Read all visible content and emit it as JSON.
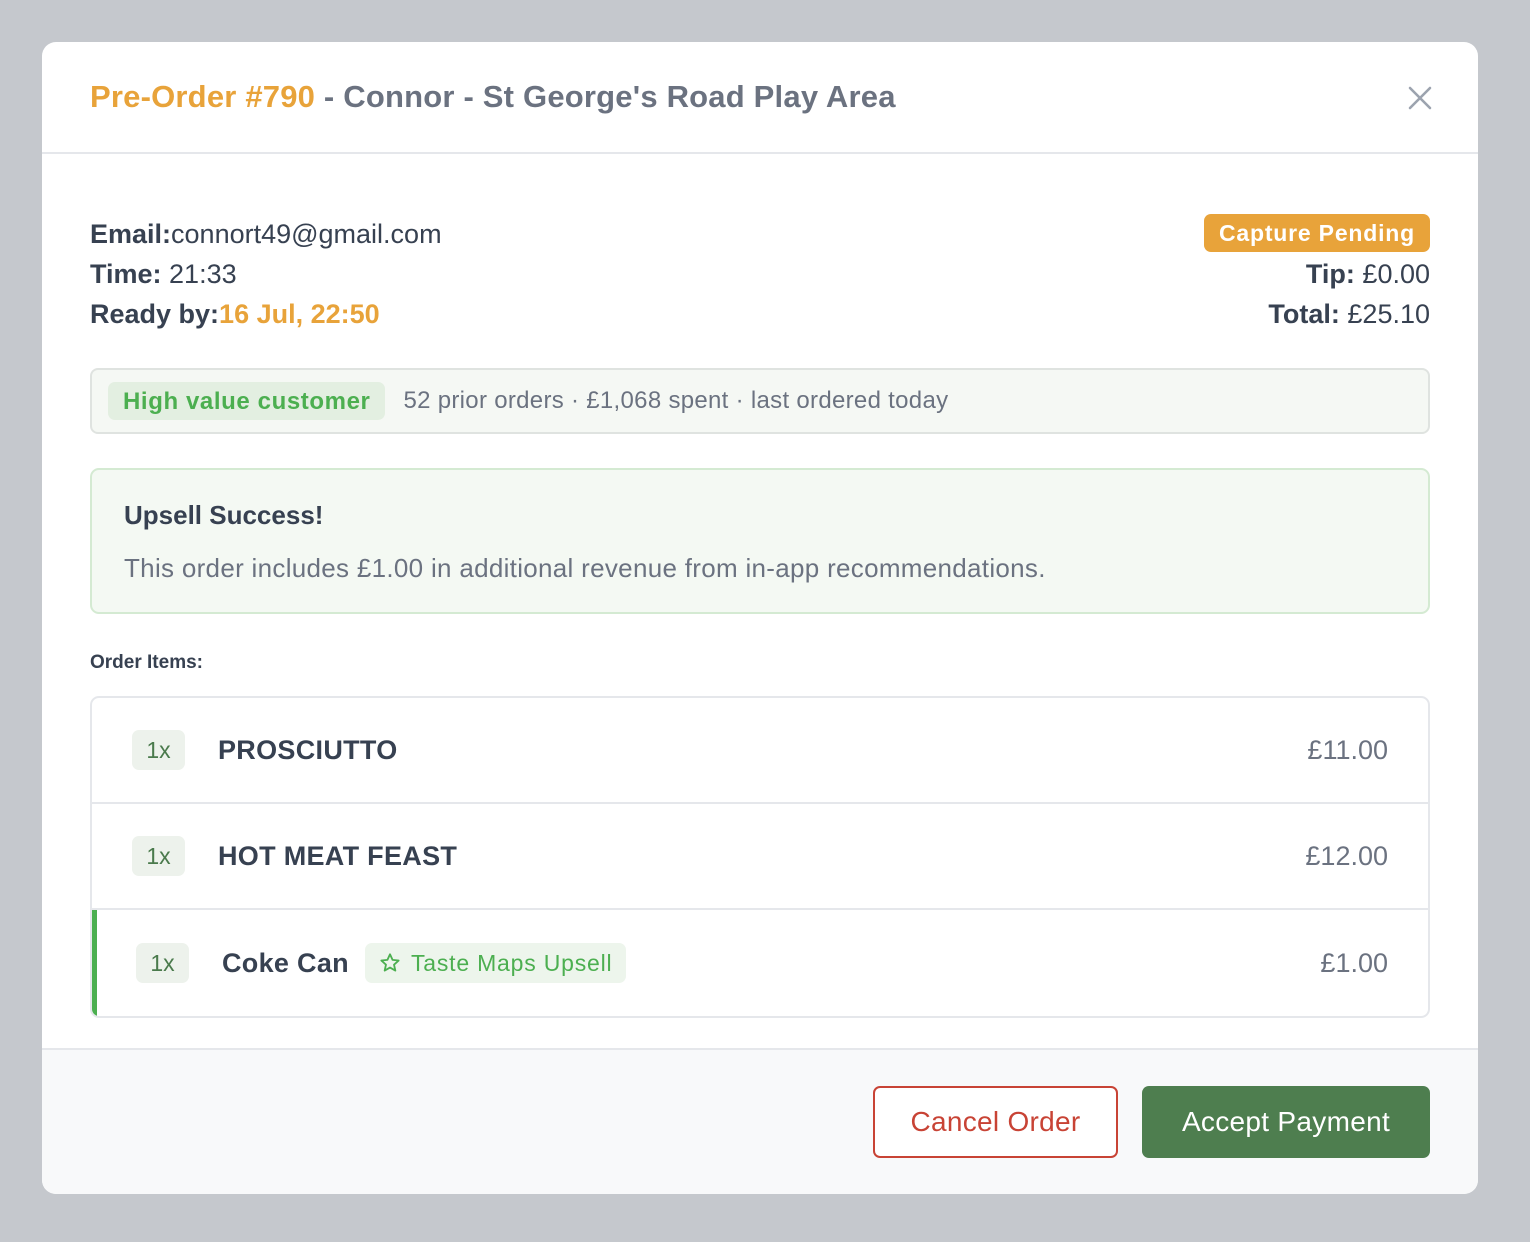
{
  "header": {
    "order_number": "Pre-Order #790",
    "title_rest": " - Connor - St George's Road Play Area"
  },
  "order_info": {
    "email_label": "Email:",
    "email_value": "connort49@gmail.com",
    "time_label": "Time:",
    "time_value": " 21:33",
    "ready_label": "Ready by:",
    "ready_value": "16 Jul, 22:50",
    "status": "Capture Pending",
    "tip_label": "Tip:",
    "tip_value": " £0.00",
    "total_label": "Total:",
    "total_value": " £25.10"
  },
  "customer": {
    "badge": "High value customer",
    "stats": "52 prior orders · £1,068 spent · last ordered today"
  },
  "upsell_notice": {
    "title": "Upsell Success!",
    "text": "This order includes £1.00 in additional revenue from in-app recommendations."
  },
  "items_label": "Order Items:",
  "items": [
    {
      "qty": "1x",
      "name": "PROSCIUTTO",
      "price": "£11.00"
    },
    {
      "qty": "1x",
      "name": "HOT MEAT FEAST",
      "price": "£12.00"
    },
    {
      "qty": "1x",
      "name": "Coke Can",
      "tag": "Taste Maps Upsell",
      "tag_icon": "star-icon",
      "price": "£1.00"
    }
  ],
  "footer": {
    "cancel_label": "Cancel Order",
    "accept_label": "Accept Payment"
  },
  "colors": {
    "accent_orange": "#e8a33a",
    "success_green": "#4caf50",
    "accept_button": "#4e7e4f",
    "cancel_red": "#c84335"
  }
}
